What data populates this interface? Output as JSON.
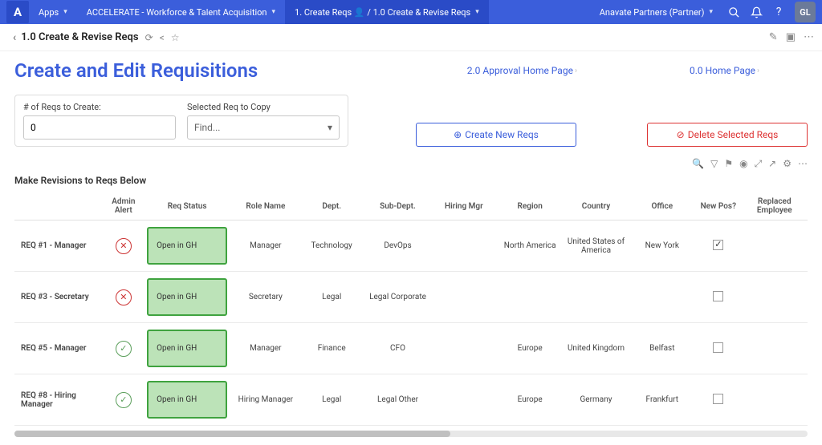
{
  "topbar": {
    "logo": "A",
    "apps_label": "Apps",
    "workspace": "ACCELERATE - Workforce & Talent Acquisition",
    "breadcrumb": "1. Create Reqs 👤 / 1.0 Create & Revise Reqs",
    "account": "Anavate Partners (Partner)",
    "avatar": "GL"
  },
  "subbar": {
    "title": "1.0 Create & Revise Reqs"
  },
  "header": {
    "title": "Create and Edit Requisitions",
    "link_approval": "2.0 Approval Home Page",
    "link_home": "0.0 Home Page"
  },
  "controls": {
    "reqs_count_label": "# of Reqs to Create:",
    "reqs_count_value": "0",
    "copy_label": "Selected Req to Copy",
    "copy_placeholder": "Find...",
    "create_btn": "Create New Reqs",
    "delete_btn": "Delete Selected Reqs"
  },
  "table": {
    "section_title": "Make Revisions to Reqs Below",
    "headers": {
      "admin_alert": "Admin Alert",
      "req_status": "Req Status",
      "role_name": "Role Name",
      "dept": "Dept.",
      "sub_dept": "Sub-Dept.",
      "hiring_mgr": "Hiring Mgr",
      "region": "Region",
      "country": "Country",
      "office": "Office",
      "new_pos": "New Pos?",
      "replaced": "Replaced Employee"
    },
    "rows": [
      {
        "id": "REQ #1 - Manager",
        "alert": "red",
        "status": "Open in GH",
        "role": "Manager",
        "dept": "Technology",
        "sub_dept": "DevOps",
        "hiring_mgr": "",
        "region": "North America",
        "country": "United States of America",
        "office": "New York",
        "new_pos": true,
        "replaced": ""
      },
      {
        "id": "REQ #3 - Secretary",
        "alert": "red",
        "status": "Open in GH",
        "role": "Secretary",
        "dept": "Legal",
        "sub_dept": "Legal Corporate",
        "hiring_mgr": "",
        "region": "",
        "country": "",
        "office": "",
        "new_pos": false,
        "replaced": ""
      },
      {
        "id": "REQ #5 - Manager",
        "alert": "green",
        "status": "Open in GH",
        "role": "Manager",
        "dept": "Finance",
        "sub_dept": "CFO",
        "hiring_mgr": "",
        "region": "Europe",
        "country": "United Kingdom",
        "office": "Belfast",
        "new_pos": false,
        "replaced": ""
      },
      {
        "id": "REQ #8 - Hiring Manager",
        "alert": "green",
        "status": "Open in GH",
        "role": "Hiring Manager",
        "dept": "Legal",
        "sub_dept": "Legal Other",
        "hiring_mgr": "",
        "region": "Europe",
        "country": "Germany",
        "office": "Frankfurt",
        "new_pos": false,
        "replaced": ""
      }
    ]
  }
}
